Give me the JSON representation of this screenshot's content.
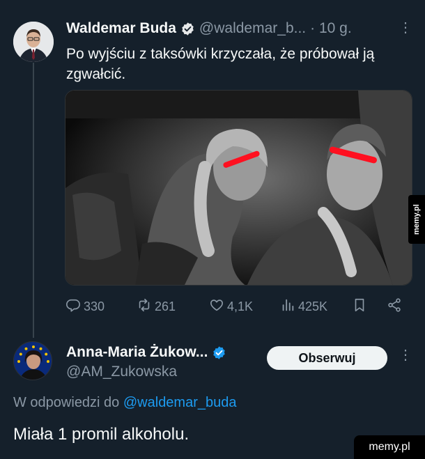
{
  "tweet1": {
    "name": "Waldemar Buda",
    "handle": "@waldemar_b...",
    "time": "· 10 g.",
    "text": "Po wyjściu z taksówki krzyczała, że próbował ją zgwałcić.",
    "stats": {
      "replies": "330",
      "reposts": "261",
      "likes": "4,1K",
      "views": "425K"
    }
  },
  "tweet2": {
    "name": "Anna-Maria Żukow...",
    "handle": "@AM_Zukowska",
    "follow_label": "Obserwuj",
    "reply_prefix": "W odpowiedzi do",
    "reply_mention": "@waldemar_buda",
    "text": "Miała 1 promil alkoholu."
  },
  "watermarks": {
    "side": "memy.pl",
    "corner": "memy.pl"
  },
  "colors": {
    "background": "#15202b",
    "text": "#f7f9f9",
    "muted": "#8b98a5",
    "accent": "#1d9bf0",
    "verified": "#1d9bf0"
  },
  "icons": {
    "verified": "verified-badge-icon",
    "reply": "reply-icon",
    "repost": "repost-icon",
    "like": "heart-icon",
    "views": "views-icon",
    "bookmark": "bookmark-icon",
    "share": "share-icon",
    "more": "more-dots-icon"
  }
}
